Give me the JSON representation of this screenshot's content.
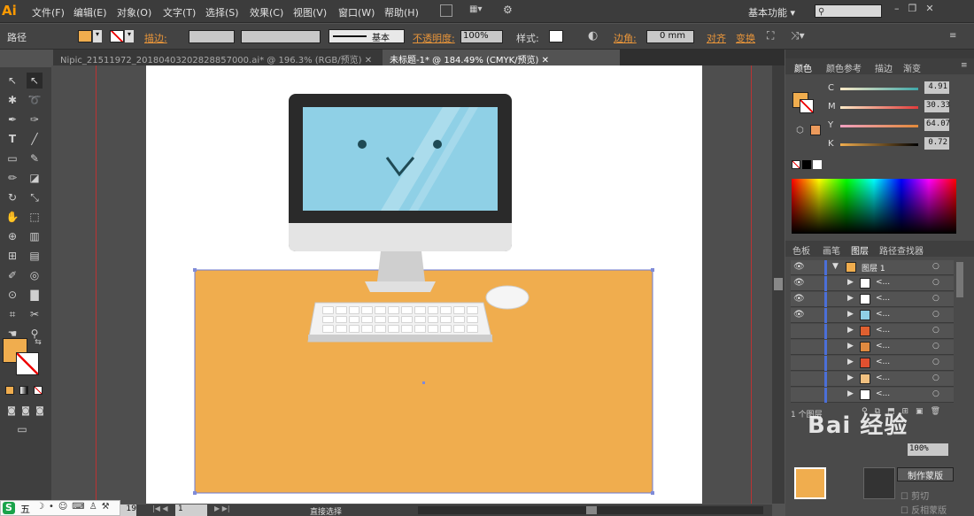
{
  "app": {
    "logo": "Ai"
  },
  "menu": [
    "文件(F)",
    "编辑(E)",
    "对象(O)",
    "文字(T)",
    "选择(S)",
    "效果(C)",
    "视图(V)",
    "窗口(W)",
    "帮助(H)"
  ],
  "workspace": {
    "label": "基本功能",
    "search_placeholder": ""
  },
  "control": {
    "mode": "路径",
    "stroke_label": "描边:",
    "stroke_style": "基本",
    "opacity_label": "不透明度:",
    "opacity_value": "100%",
    "style_label": "样式:",
    "corner_label": "边角:",
    "corner_value": "0 mm",
    "align_label": "对齐",
    "transform_label": "变换"
  },
  "tabs": [
    {
      "label": "Nipic_21511972_20180403202828857000.ai* @ 196.3% (RGB/预览)"
    },
    {
      "label": "未标题-1* @ 184.49% (CMYK/预览)"
    }
  ],
  "color_panel": {
    "tabs": [
      "颜色",
      "颜色参考",
      "描边",
      "渐变"
    ],
    "channels": [
      {
        "name": "C",
        "value": "4.91"
      },
      {
        "name": "M",
        "value": "30.33"
      },
      {
        "name": "Y",
        "value": "64.07"
      },
      {
        "name": "K",
        "value": "0.72"
      }
    ],
    "fill_color": "#f0ad4e"
  },
  "layers_panel": {
    "tabs": [
      "色板",
      "画笔",
      "图层",
      "路径查找器"
    ],
    "layer_name": "图层 1",
    "row_label": "<...",
    "count_label": "1 个图层"
  },
  "transparency": {
    "opacity": "100%",
    "make_mask": "制作蒙版",
    "clip_label": "剪切",
    "invert_label": "反相蒙版"
  },
  "status": {
    "zoom": "19",
    "page": "1",
    "tool": "直接选择"
  },
  "watermark": "Bai 经验",
  "ime": [
    "五"
  ]
}
